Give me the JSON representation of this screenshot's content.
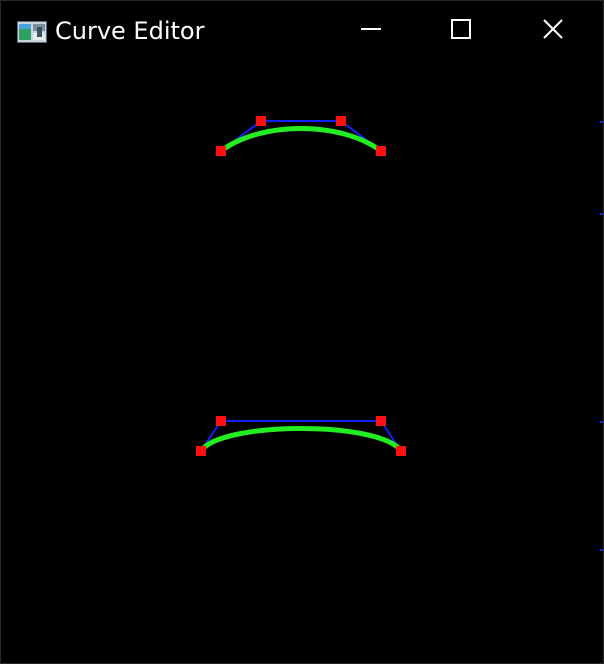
{
  "window": {
    "title": "Curve Editor",
    "icon": "app-icon",
    "controls": [
      "minimize-icon",
      "maximize-icon",
      "close-icon"
    ]
  },
  "colors": {
    "background": "#000000",
    "curve": "#22ee22",
    "control_polygon": "#1020ff",
    "control_point": "#ff1010"
  },
  "curves": [
    {
      "name": "upper-curve"
    },
    {
      "name": "lower-curve"
    }
  ]
}
